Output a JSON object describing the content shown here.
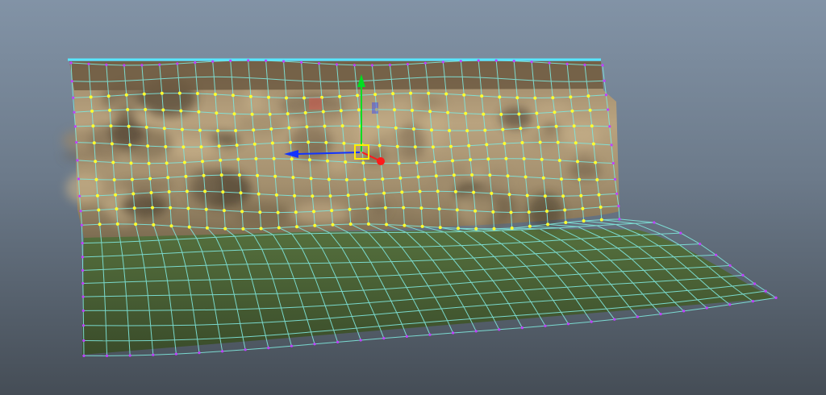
{
  "viewport": {
    "background_top": "#8293a6",
    "background_bottom": "#454d56"
  },
  "mesh": {
    "wire_color": "#7fe6dc",
    "border_vertex_color": "#c040ff",
    "selected_vertex_color": "#ffff30",
    "rock_colors": [
      "#9a8668",
      "#c6b089",
      "#6b5a44",
      "#3e3427"
    ],
    "grass_colors": [
      "#4f6538",
      "#3a4c2a"
    ],
    "top_edge_color": "#58e6ff"
  },
  "manipulator": {
    "tool": "move-tool",
    "axes": [
      {
        "axis": "y",
        "color": "#00dd22"
      },
      {
        "axis": "x",
        "color": "#1133ff"
      },
      {
        "axis": "z",
        "color": "#ff1a1a"
      }
    ],
    "center_handle_color": "#ffee00"
  }
}
